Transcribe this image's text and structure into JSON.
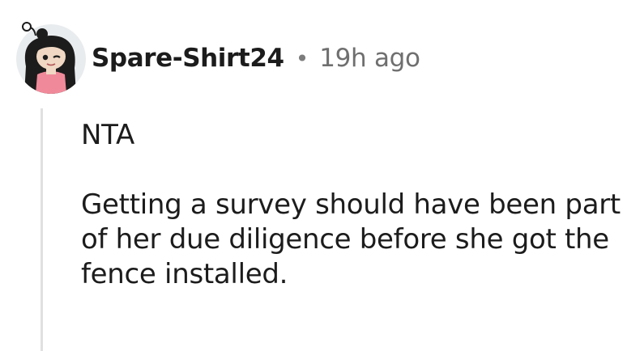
{
  "comment": {
    "username": "Spare-Shirt24",
    "separator": "•",
    "timestamp": "19h ago",
    "avatar_icon": "snoo-avatar-icon",
    "paragraphs": [
      "NTA",
      "Getting a survey should have been part of her due diligence before she got the fence installed."
    ]
  },
  "colors": {
    "text": "#1c1c1c",
    "meta": "#6f6f6f",
    "thread_line": "#e0e0e0",
    "avatar_bg": "#e9ecee",
    "shirt": "#f08a9a"
  }
}
